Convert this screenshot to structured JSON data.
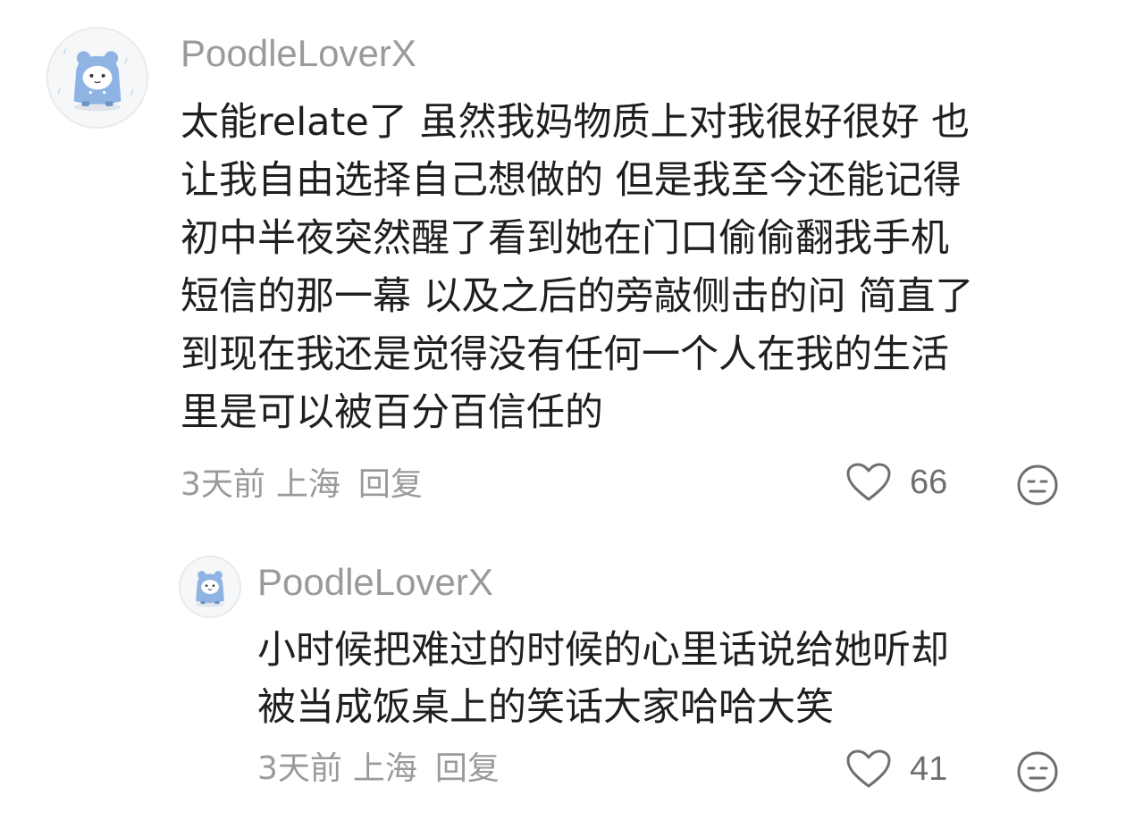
{
  "comments": [
    {
      "username": "PoodleLoverX",
      "text": "太能relate了 虽然我妈物质上对我很好很好 也\n让我自由选择自己想做的 但是我至今还能记得\n初中半夜突然醒了看到她在门口偷偷翻我手机\n短信的那一幕 以及之后的旁敲侧击的问 简直了\n到现在我还是觉得没有任何一个人在我的生活\n里是可以被百分百信任的",
      "time": "3天前",
      "location": "上海",
      "reply_label": "回复",
      "likes": "66"
    },
    {
      "username": "PoodleLoverX",
      "text": "小时候把难过的时候的心里话说给她听却\n被当成饭桌上的笑话大家哈哈大笑",
      "time": "3天前",
      "location": "上海",
      "reply_label": "回复",
      "likes": "41"
    }
  ],
  "colors": {
    "text": "#1f1f1f",
    "muted": "#9a9a9a",
    "icon": "#6f6f6f",
    "avatar_blue": "#8fb4e3"
  },
  "icons": {
    "like": "heart-outline-icon",
    "dislike": "neutral-face-icon",
    "avatar": "blue-bear-raincoat-avatar"
  }
}
